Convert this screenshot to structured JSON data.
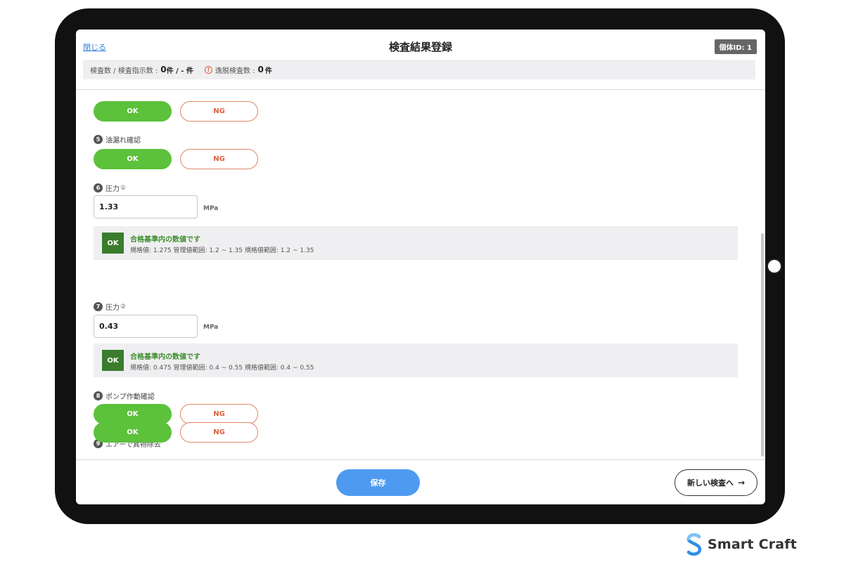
{
  "header": {
    "close_label": "閉じる",
    "title": "検査結果登録",
    "id_badge": "個体ID: 1"
  },
  "summary": {
    "count_label": "検査数 / 検査指示数 :",
    "count_value": "0",
    "count_unit": "件 / - 件",
    "deviation_label": "逸脱検査数 :",
    "deviation_value": "0",
    "deviation_unit": "件"
  },
  "ok_label": "OK",
  "ng_label": "NG",
  "items": [
    {
      "number": "5",
      "label": "油漏れ確認"
    },
    {
      "number": "6",
      "label": "圧力",
      "mark": "①",
      "value": "1.33",
      "unit": "MPa",
      "result_title": "合格基準内の数値です",
      "result_detail": "規格値: 1.275 管理値範囲: 1.2 ~ 1.35 規格値範囲: 1.2 ~ 1.35",
      "result_chip": "OK"
    },
    {
      "number": "7",
      "label": "圧力",
      "mark": "②",
      "value": "0.43",
      "unit": "MPa",
      "result_title": "合格基準内の数値です",
      "result_detail": "規格値: 0.475 管理値範囲: 0.4 ~ 0.55 規格値範囲: 0.4 ~ 0.55",
      "result_chip": "OK"
    },
    {
      "number": "8",
      "label": "ポンプ作動確認"
    },
    {
      "number": "9",
      "label": "エアーで異物除去"
    }
  ],
  "footer": {
    "save_label": "保存",
    "new_inspection_label": "新しい検査へ",
    "arrow": "→"
  },
  "logo": {
    "text": "Smart Craft",
    "color": "#2f8fe6"
  },
  "colors": {
    "ok_green": "#5cc13b",
    "ng_orange": "#e0603c",
    "save_blue": "#4e9af0"
  }
}
